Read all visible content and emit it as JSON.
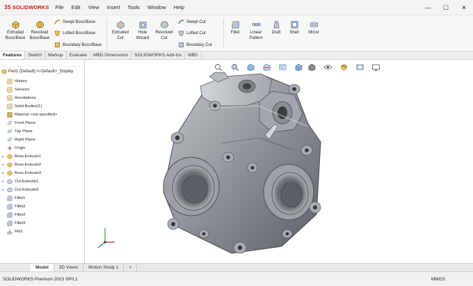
{
  "app": {
    "logo_ds": "3S",
    "logo_text": "SOLIDWORKS"
  },
  "menu": [
    "File",
    "Edit",
    "View",
    "Insert",
    "Tools",
    "Window",
    "Help"
  ],
  "window_controls": {
    "minimize": "—",
    "maximize": "☐",
    "close": "✕"
  },
  "ribbon": {
    "extruded_boss": "Extruded Boss/Base",
    "revolved_boss": "Revolved Boss/Base",
    "swept_boss": "Swept Boss/Base",
    "lofted_boss": "Lofted Boss/Base",
    "boundary_boss": "Boundary Boss/Base",
    "extruded_cut": "Extruded Cut",
    "hole_wizard": "Hole Wizard",
    "revolved_cut": "Revolved Cut",
    "swept_cut": "Swept Cut",
    "lofted_cut": "Lofted Cut",
    "boundary_cut": "Boundary Cut",
    "fillet": "Fillet",
    "linear_pattern": "Linear Pattern",
    "draft": "Draft",
    "shell": "Shell",
    "mirror": "Mirror"
  },
  "cm_tabs": [
    "Features",
    "Sketch",
    "Markup",
    "Evaluate",
    "MBD Dimensions",
    "SOLIDWORKS Add-Ins",
    "MBD"
  ],
  "tree": {
    "part_label": "Part1  (Default) <<Default>_Display",
    "items": [
      {
        "label": "History",
        "icon": "history-icon",
        "expandable": false
      },
      {
        "label": "Sensors",
        "icon": "sensors-icon",
        "expandable": false
      },
      {
        "label": "Annotations",
        "icon": "annotations-icon",
        "expandable": false
      },
      {
        "label": "Solid Bodies(1)",
        "icon": "solid-bodies-icon",
        "expandable": false
      },
      {
        "label": "Material <not specified>",
        "icon": "material-icon",
        "expandable": false
      },
      {
        "label": "Front Plane",
        "icon": "plane-icon",
        "expandable": false
      },
      {
        "label": "Top Plane",
        "icon": "plane-icon",
        "expandable": false
      },
      {
        "label": "Right Plane",
        "icon": "plane-icon",
        "expandable": false
      },
      {
        "label": "Origin",
        "icon": "origin-icon",
        "expandable": false
      },
      {
        "label": "Boss-Extrude1",
        "icon": "extrude-icon",
        "expandable": true
      },
      {
        "label": "Boss-Extrude2",
        "icon": "extrude-icon",
        "expandable": true
      },
      {
        "label": "Boss-Extrude3",
        "icon": "extrude-icon",
        "expandable": true
      },
      {
        "label": "Cut-Extrude1",
        "icon": "cut-icon",
        "expandable": true
      },
      {
        "label": "Cut-Extrude3",
        "icon": "cut-icon",
        "expandable": true
      },
      {
        "label": "Fillet1",
        "icon": "fillet-icon",
        "expandable": false
      },
      {
        "label": "Fillet2",
        "icon": "fillet-icon",
        "expandable": false
      },
      {
        "label": "Fillet2",
        "icon": "fillet-icon",
        "expandable": false
      },
      {
        "label": "Fillet3",
        "icon": "fillet-icon",
        "expandable": false
      },
      {
        "label": "Rib1",
        "icon": "rib-icon",
        "expandable": false
      }
    ]
  },
  "bottom_tabs": [
    "Model",
    "3D Views",
    "Motion Study 1",
    "+"
  ],
  "status": {
    "version": "SOLIDWORKS Premium 2023 SP0.1",
    "units": "MMGS"
  },
  "colors": {
    "brand_red": "#d6121c",
    "accent_blue": "#2a6ebd",
    "part_gray": "#9a9da3"
  }
}
